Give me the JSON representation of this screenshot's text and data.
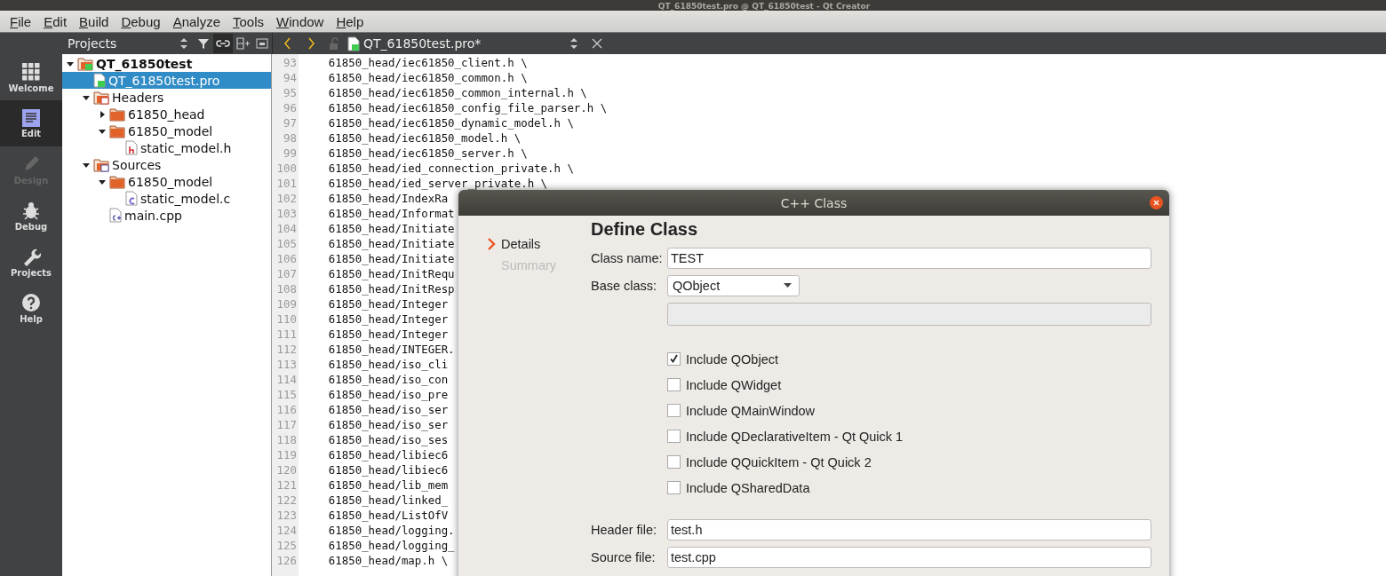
{
  "window": {
    "title": "QT_61850test.pro @ QT_61850test - Qt Creator"
  },
  "menu": [
    "File",
    "Edit",
    "Build",
    "Debug",
    "Analyze",
    "Tools",
    "Window",
    "Help"
  ],
  "modes": [
    {
      "label": "Welcome",
      "kind": "welcome",
      "selected": false,
      "disabled": false
    },
    {
      "label": "Edit",
      "kind": "edit",
      "selected": true,
      "disabled": false
    },
    {
      "label": "Design",
      "kind": "design",
      "selected": false,
      "disabled": true
    },
    {
      "label": "Debug",
      "kind": "debug",
      "selected": false,
      "disabled": false
    },
    {
      "label": "Projects",
      "kind": "projects",
      "selected": false,
      "disabled": false
    },
    {
      "label": "Help",
      "kind": "help",
      "selected": false,
      "disabled": false
    }
  ],
  "projects_panel": {
    "title": "Projects",
    "tree": [
      {
        "label": "QT_61850test",
        "kind": "project",
        "expanded": true,
        "selected": false,
        "children": [
          {
            "label": "QT_61850test.pro",
            "kind": "pro",
            "selected": true
          },
          {
            "label": "Headers",
            "kind": "headers",
            "expanded": true,
            "selected": false,
            "children": [
              {
                "label": "61850_head",
                "kind": "folder",
                "expanded": false,
                "selected": false
              },
              {
                "label": "61850_model",
                "kind": "folder",
                "expanded": true,
                "selected": false,
                "children": [
                  {
                    "label": "static_model.h",
                    "kind": "h",
                    "selected": false
                  }
                ]
              }
            ]
          },
          {
            "label": "Sources",
            "kind": "sources",
            "expanded": true,
            "selected": false,
            "children": [
              {
                "label": "61850_model",
                "kind": "folder",
                "expanded": true,
                "selected": false,
                "children": [
                  {
                    "label": "static_model.c",
                    "kind": "c",
                    "selected": false
                  }
                ]
              },
              {
                "label": "main.cpp",
                "kind": "cpp",
                "selected": false
              }
            ]
          }
        ]
      }
    ]
  },
  "editor": {
    "tab": "QT_61850test.pro*",
    "lines": [
      {
        "number": "93",
        "text": "    61850_head/iec61850_client.h \\"
      },
      {
        "number": "94",
        "text": "    61850_head/iec61850_common.h \\"
      },
      {
        "number": "95",
        "text": "    61850_head/iec61850_common_internal.h \\"
      },
      {
        "number": "96",
        "text": "    61850_head/iec61850_config_file_parser.h \\"
      },
      {
        "number": "97",
        "text": "    61850_head/iec61850_dynamic_model.h \\"
      },
      {
        "number": "98",
        "text": "    61850_head/iec61850_model.h \\"
      },
      {
        "number": "99",
        "text": "    61850_head/iec61850_server.h \\"
      },
      {
        "number": "100",
        "text": "    61850_head/ied_connection_private.h \\"
      },
      {
        "number": "101",
        "text": "    61850_head/ied_server_private.h \\"
      },
      {
        "number": "102",
        "text": "    61850_head/IndexRa"
      },
      {
        "number": "103",
        "text": "    61850_head/Informat"
      },
      {
        "number": "104",
        "text": "    61850_head/Initiate"
      },
      {
        "number": "105",
        "text": "    61850_head/Initiate"
      },
      {
        "number": "106",
        "text": "    61850_head/Initiate"
      },
      {
        "number": "107",
        "text": "    61850_head/InitRequ"
      },
      {
        "number": "108",
        "text": "    61850_head/InitResp"
      },
      {
        "number": "109",
        "text": "    61850_head/Integer"
      },
      {
        "number": "110",
        "text": "    61850_head/Integer"
      },
      {
        "number": "111",
        "text": "    61850_head/Integer"
      },
      {
        "number": "112",
        "text": "    61850_head/INTEGER."
      },
      {
        "number": "113",
        "text": "    61850_head/iso_cli"
      },
      {
        "number": "114",
        "text": "    61850_head/iso_con"
      },
      {
        "number": "115",
        "text": "    61850_head/iso_pre"
      },
      {
        "number": "116",
        "text": "    61850_head/iso_ser"
      },
      {
        "number": "117",
        "text": "    61850_head/iso_ser"
      },
      {
        "number": "118",
        "text": "    61850_head/iso_ses"
      },
      {
        "number": "119",
        "text": "    61850_head/libiec6"
      },
      {
        "number": "120",
        "text": "    61850_head/libiec6"
      },
      {
        "number": "121",
        "text": "    61850_head/lib_mem"
      },
      {
        "number": "122",
        "text": "    61850_head/linked_"
      },
      {
        "number": "123",
        "text": "    61850_head/ListOfV"
      },
      {
        "number": "124",
        "text": "    61850_head/logging."
      },
      {
        "number": "125",
        "text": "    61850_head/logging_"
      },
      {
        "number": "126",
        "text": "    61850_head/map.h \\"
      }
    ]
  },
  "dialog": {
    "title": "C++ Class",
    "steps": [
      {
        "label": "Details",
        "selected": true
      },
      {
        "label": "Summary",
        "selected": false
      }
    ],
    "heading": "Define Class",
    "class_name": {
      "label": "Class name:",
      "value": "TEST"
    },
    "base_class": {
      "label": "Base class:",
      "value": "QObject"
    },
    "checkboxes": [
      {
        "label": "Include QObject",
        "checked": true
      },
      {
        "label": "Include QWidget",
        "checked": false
      },
      {
        "label": "Include QMainWindow",
        "checked": false
      },
      {
        "label": "Include QDeclarativeItem - Qt Quick 1",
        "checked": false
      },
      {
        "label": "Include QQuickItem - Qt Quick 2",
        "checked": false
      },
      {
        "label": "Include QSharedData",
        "checked": false
      }
    ],
    "header_file": {
      "label": "Header file:",
      "value": "test.h"
    },
    "source_file": {
      "label": "Source file:",
      "value": "test.cpp"
    }
  }
}
